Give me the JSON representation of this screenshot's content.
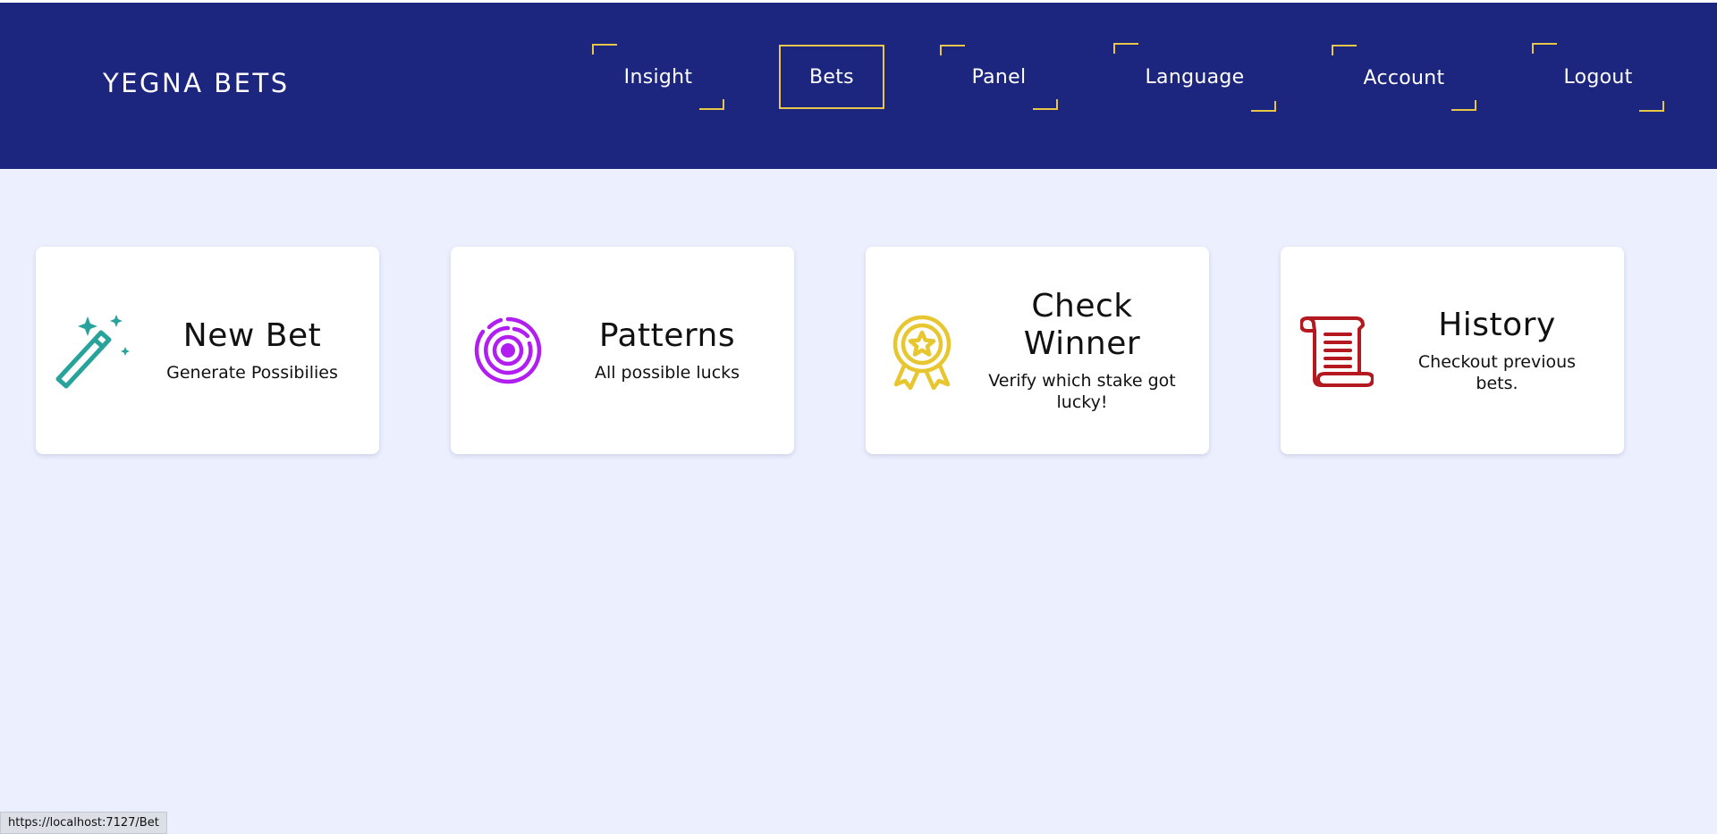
{
  "header": {
    "brand": "YEGNA BETS",
    "nav": [
      {
        "label": "Insight",
        "active": false
      },
      {
        "label": "Bets",
        "active": true
      },
      {
        "label": "Panel",
        "active": false
      },
      {
        "label": "Language",
        "active": false
      },
      {
        "label": "Account",
        "active": false
      },
      {
        "label": "Logout",
        "active": false
      }
    ]
  },
  "cards": [
    {
      "title": "New Bet",
      "description": "Generate Possibilies",
      "icon": "magic-wand-icon",
      "color": "#27a39b"
    },
    {
      "title": "Patterns",
      "description": "All possible lucks",
      "icon": "target-icon",
      "color": "#b01ef0"
    },
    {
      "title": "Check Winner",
      "description": "Verify which stake got lucky!",
      "icon": "award-ribbon-icon",
      "color": "#e8c62f"
    },
    {
      "title": "History",
      "description": "Checkout previous bets.",
      "icon": "scroll-icon",
      "color": "#b3191f"
    }
  ],
  "status_bar": {
    "url": "https://localhost:7127/Bet"
  },
  "colors": {
    "header_bg": "#1c267e",
    "accent": "#e8c64a",
    "page_bg": "#ecf0fe"
  }
}
